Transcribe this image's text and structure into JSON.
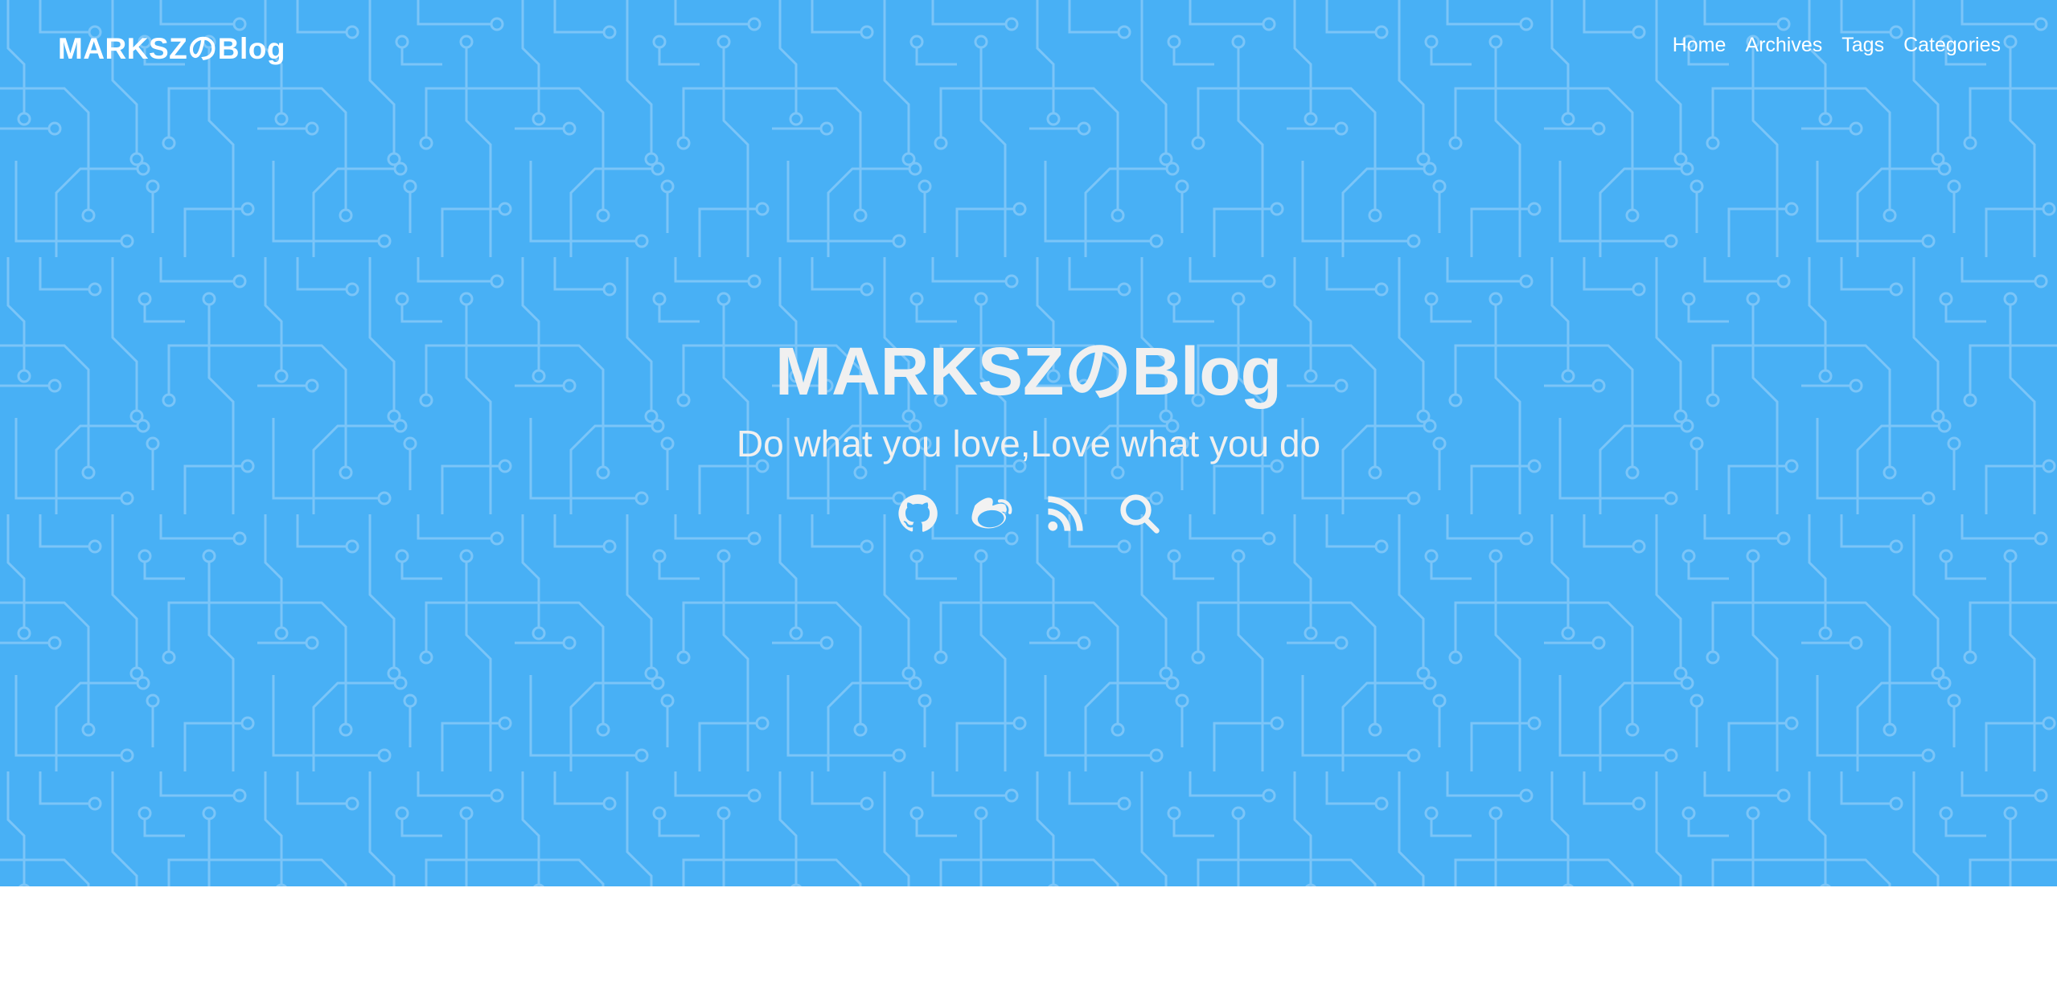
{
  "header": {
    "brand": "MARKSZのBlog",
    "nav": [
      {
        "label": "Home"
      },
      {
        "label": "Archives"
      },
      {
        "label": "Tags"
      },
      {
        "label": "Categories"
      }
    ]
  },
  "hero": {
    "title": "MARKSZのBlog",
    "subtitle": "Do what you love,Love what you do",
    "icons": [
      "github-icon",
      "weibo-icon",
      "rss-icon",
      "search-icon"
    ],
    "background_color": "#48b0f5",
    "pattern_color": "#7fc8f8"
  }
}
